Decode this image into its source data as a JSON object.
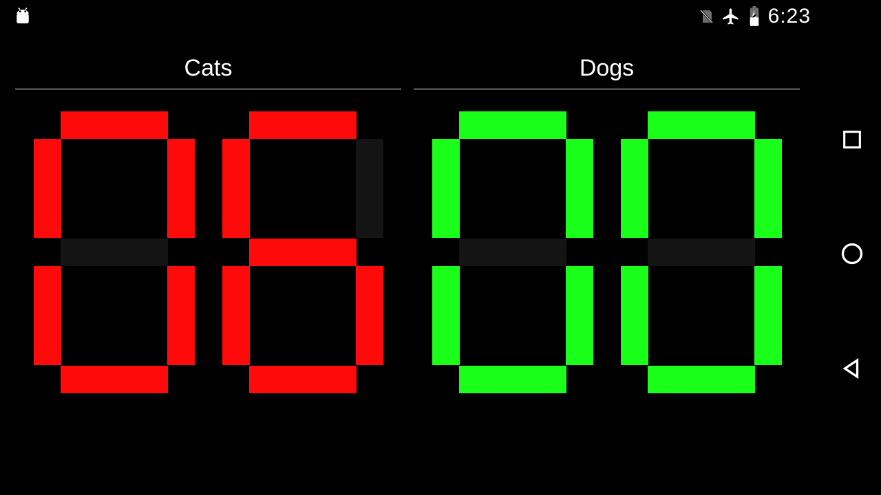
{
  "status": {
    "time": "6:23"
  },
  "panels": [
    {
      "label": "Cats",
      "score": "06",
      "on_color": "#ff0a0a",
      "off_color": "#141414"
    },
    {
      "label": "Dogs",
      "score": "00",
      "on_color": "#1aff1a",
      "off_color": "#141414"
    }
  ]
}
